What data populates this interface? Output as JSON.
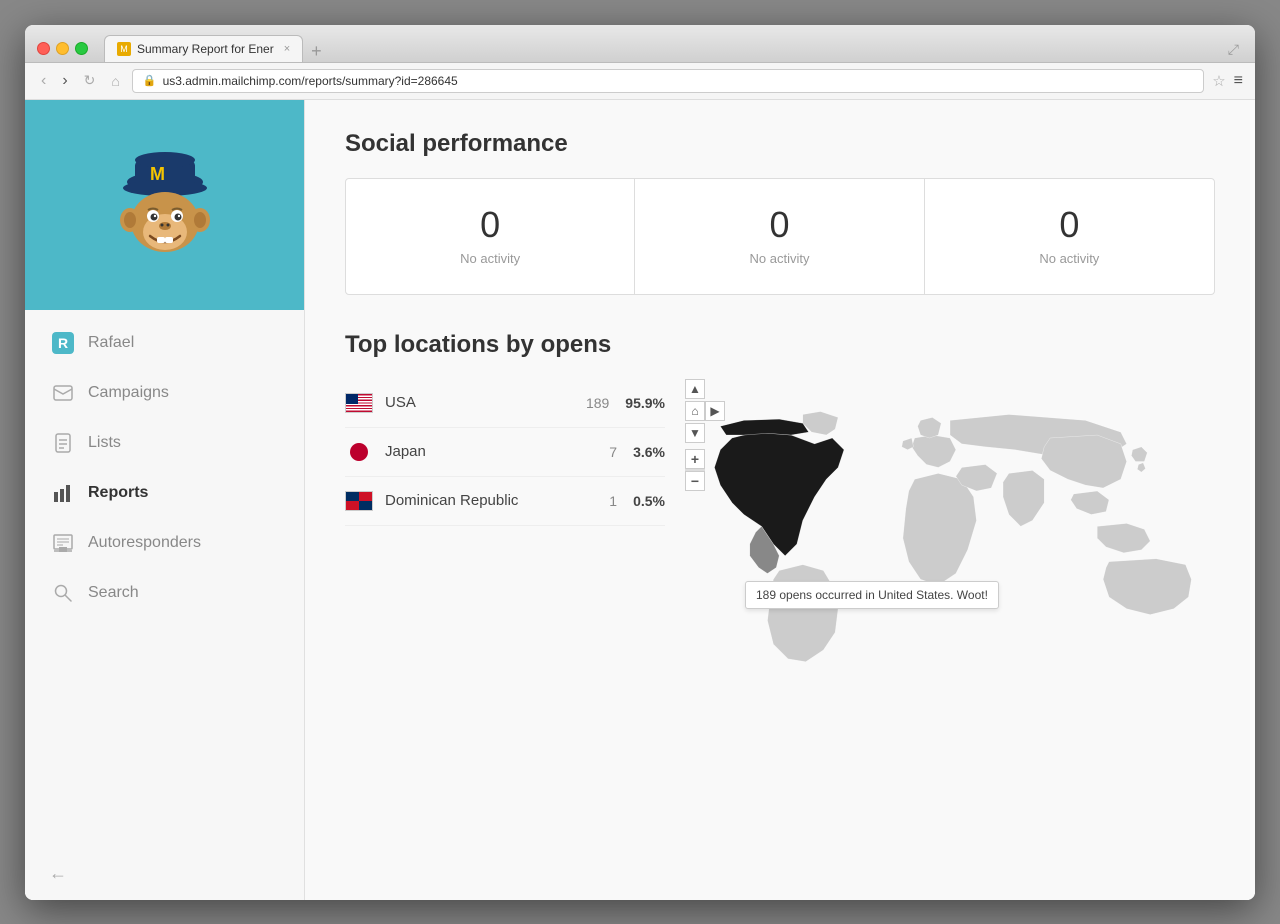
{
  "browser": {
    "url_protocol": "https://",
    "url_domain": "us3.admin.mailchimp.com",
    "url_path": "/reports/summary?id=286645",
    "tab_title": "Summary Report for Ener",
    "tab_close": "×",
    "nav_back": "‹",
    "nav_forward": "›",
    "nav_refresh": "↻",
    "nav_home": "⌂",
    "star": "☆",
    "menu": "≡"
  },
  "sidebar": {
    "header_bg": "#4db8c8",
    "user_initial": "R",
    "user_name": "Rafael",
    "items": [
      {
        "id": "user",
        "label": "Rafael",
        "icon_type": "initial"
      },
      {
        "id": "campaigns",
        "label": "Campaigns",
        "icon": "✉"
      },
      {
        "id": "lists",
        "label": "Lists",
        "icon": "📄"
      },
      {
        "id": "reports",
        "label": "Reports",
        "icon": "📊",
        "active": true
      },
      {
        "id": "autoresponders",
        "label": "Autoresponders",
        "icon": "📋"
      },
      {
        "id": "search",
        "label": "Search",
        "icon": "🔍"
      }
    ],
    "collapse_icon": "←"
  },
  "social_performance": {
    "title": "Social performance",
    "cards": [
      {
        "number": "0",
        "label": "No activity"
      },
      {
        "number": "0",
        "label": "No activity"
      },
      {
        "number": "0",
        "label": "No activity"
      }
    ]
  },
  "top_locations": {
    "title": "Top locations by opens",
    "items": [
      {
        "country": "USA",
        "flag_type": "usa",
        "count": "189",
        "pct": "95.9%"
      },
      {
        "country": "Japan",
        "flag_type": "japan",
        "count": "7",
        "pct": "3.6%"
      },
      {
        "country": "Dominican Republic",
        "flag_type": "dr",
        "count": "1",
        "pct": "0.5%"
      }
    ],
    "map_tooltip": "189 opens occurred in United States. Woot!"
  }
}
